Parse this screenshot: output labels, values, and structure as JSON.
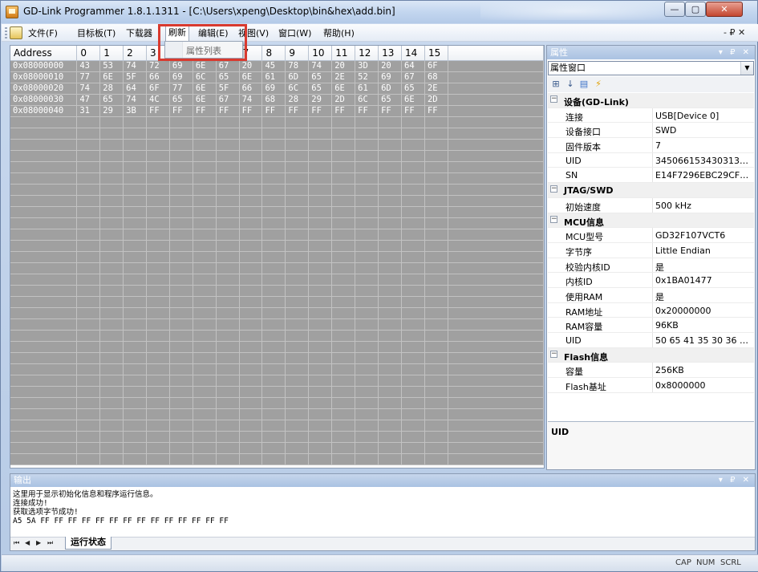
{
  "window": {
    "title": "GD-Link Programmer 1.8.1.1311 - [C:\\Users\\xpeng\\Desktop\\bin&hex\\add.bin]",
    "min_glyph": "—",
    "max_glyph": "▢",
    "close_glyph": "✕"
  },
  "menubar": {
    "items": [
      "文件(F)",
      "目标板(T)",
      "下载器",
      "刷新",
      "编辑(E)",
      "视图(V)",
      "窗口(W)",
      "帮助(H)"
    ],
    "mdi_controls": "- ₽ ✕",
    "dropdown_item": "属性列表"
  },
  "grid": {
    "headers": [
      "Address",
      "0",
      "1",
      "2",
      "3",
      "4",
      "5",
      "6",
      "7",
      "8",
      "9",
      "10",
      "11",
      "12",
      "13",
      "14",
      "15"
    ],
    "rows": [
      [
        "0x08000000",
        "43",
        "53",
        "74",
        "72",
        "69",
        "6E",
        "67",
        "20",
        "45",
        "78",
        "74",
        "20",
        "3D",
        "20",
        "64",
        "6F"
      ],
      [
        "0x08000010",
        "77",
        "6E",
        "5F",
        "66",
        "69",
        "6C",
        "65",
        "6E",
        "61",
        "6D",
        "65",
        "2E",
        "52",
        "69",
        "67",
        "68"
      ],
      [
        "0x08000020",
        "74",
        "28",
        "64",
        "6F",
        "77",
        "6E",
        "5F",
        "66",
        "69",
        "6C",
        "65",
        "6E",
        "61",
        "6D",
        "65",
        "2E"
      ],
      [
        "0x08000030",
        "47",
        "65",
        "74",
        "4C",
        "65",
        "6E",
        "67",
        "74",
        "68",
        "28",
        "29",
        "2D",
        "6C",
        "65",
        "6E",
        "2D"
      ],
      [
        "0x08000040",
        "31",
        "29",
        "3B",
        "FF",
        "FF",
        "FF",
        "FF",
        "FF",
        "FF",
        "FF",
        "FF",
        "FF",
        "FF",
        "FF",
        "FF",
        "FF"
      ]
    ]
  },
  "properties": {
    "header": "属性",
    "header_controls": "▾ ₽ ✕",
    "combo_value": "属性窗口",
    "toolbar_icons": [
      "categorized-icon",
      "sort-az-icon",
      "pages-icon",
      "events-icon"
    ],
    "rows": [
      {
        "type": "cat",
        "name": "设备(GD-Link)"
      },
      {
        "type": "prop",
        "name": "连接",
        "value": "USB[Device 0]"
      },
      {
        "type": "prop",
        "name": "设备接口",
        "value": "SWD"
      },
      {
        "type": "prop",
        "name": "固件版本",
        "value": "7"
      },
      {
        "type": "prop",
        "name": "UID",
        "value": "345066153430313533..."
      },
      {
        "type": "prop",
        "name": "SN",
        "value": "E14F7296EBC29CF461..."
      },
      {
        "type": "cat",
        "name": "JTAG/SWD"
      },
      {
        "type": "prop",
        "name": "初始速度",
        "value": "500 kHz"
      },
      {
        "type": "cat",
        "name": "MCU信息"
      },
      {
        "type": "prop",
        "name": "MCU型号",
        "value": "GD32F107VCT6"
      },
      {
        "type": "prop",
        "name": "字节序",
        "value": "Little Endian"
      },
      {
        "type": "prop",
        "name": "校验内核ID",
        "value": "是"
      },
      {
        "type": "prop",
        "name": "内核ID",
        "value": "0x1BA01477"
      },
      {
        "type": "prop",
        "name": "使用RAM",
        "value": "是"
      },
      {
        "type": "prop",
        "name": "RAM地址",
        "value": "0x20000000"
      },
      {
        "type": "prop",
        "name": "RAM容量",
        "value": "96KB"
      },
      {
        "type": "prop",
        "name": "UID",
        "value": "50 65 41 35 30 36 31 3..."
      },
      {
        "type": "cat",
        "name": "Flash信息"
      },
      {
        "type": "prop",
        "name": "容量",
        "value": "256KB"
      },
      {
        "type": "prop",
        "name": "Flash基址",
        "value": "0x8000000"
      }
    ],
    "description_title": "UID"
  },
  "output": {
    "header": "输出",
    "header_controls": "▾ ₽ ✕",
    "lines": [
      "这里用于显示初始化信息和程序运行信息。",
      "连接成功!",
      "获取选项字节成功!",
      "A5 5A FF FF FF FF FF FF FF FF FF FF FF FF FF FF"
    ],
    "nav_glyphs": [
      "⏮",
      "◀",
      "▶",
      "⏭"
    ],
    "tab_label": "运行状态"
  },
  "statusbar": {
    "cap": "CAP",
    "num": "NUM",
    "scrl": "SCRL"
  }
}
